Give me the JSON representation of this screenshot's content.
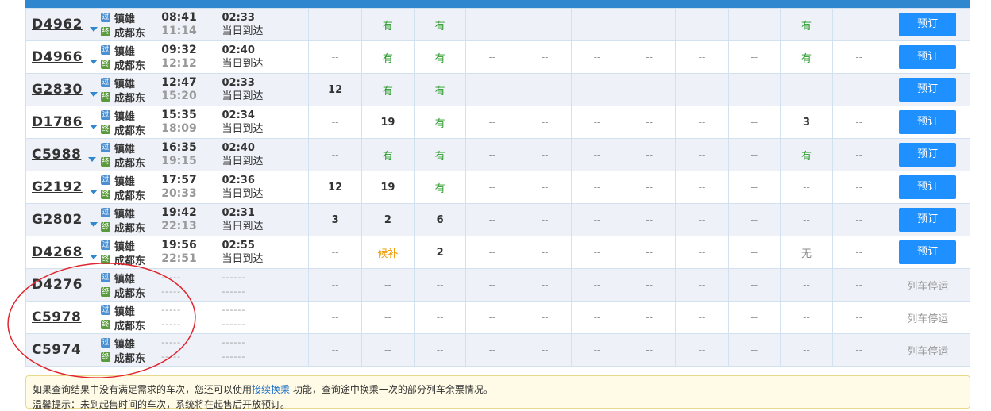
{
  "rows": [
    {
      "train": "D4962",
      "from_badge": "过",
      "from": "镇雄",
      "to_badge": "终",
      "to": "成都东",
      "dep": "08:41",
      "arr": "11:14",
      "dur": "02:33",
      "note": "当日到达",
      "seats": [
        "--",
        "有",
        "有",
        "--",
        "--",
        "--",
        "--",
        "--",
        "--",
        "有",
        "--"
      ],
      "action": "预订",
      "bookable": true
    },
    {
      "train": "D4966",
      "from_badge": "过",
      "from": "镇雄",
      "to_badge": "终",
      "to": "成都东",
      "dep": "09:32",
      "arr": "12:12",
      "dur": "02:40",
      "note": "当日到达",
      "seats": [
        "--",
        "有",
        "有",
        "--",
        "--",
        "--",
        "--",
        "--",
        "--",
        "有",
        "--"
      ],
      "action": "预订",
      "bookable": true
    },
    {
      "train": "G2830",
      "from_badge": "过",
      "from": "镇雄",
      "to_badge": "终",
      "to": "成都东",
      "dep": "12:47",
      "arr": "15:20",
      "dur": "02:33",
      "note": "当日到达",
      "seats": [
        "12",
        "有",
        "有",
        "--",
        "--",
        "--",
        "--",
        "--",
        "--",
        "--",
        "--"
      ],
      "action": "预订",
      "bookable": true
    },
    {
      "train": "D1786",
      "from_badge": "过",
      "from": "镇雄",
      "to_badge": "终",
      "to": "成都东",
      "dep": "15:35",
      "arr": "18:09",
      "dur": "02:34",
      "note": "当日到达",
      "seats": [
        "--",
        "19",
        "有",
        "--",
        "--",
        "--",
        "--",
        "--",
        "--",
        "3",
        "--"
      ],
      "action": "预订",
      "bookable": true
    },
    {
      "train": "C5988",
      "from_badge": "过",
      "from": "镇雄",
      "to_badge": "终",
      "to": "成都东",
      "dep": "16:35",
      "arr": "19:15",
      "dur": "02:40",
      "note": "当日到达",
      "seats": [
        "--",
        "有",
        "有",
        "--",
        "--",
        "--",
        "--",
        "--",
        "--",
        "有",
        "--"
      ],
      "action": "预订",
      "bookable": true
    },
    {
      "train": "G2192",
      "from_badge": "过",
      "from": "镇雄",
      "to_badge": "终",
      "to": "成都东",
      "dep": "17:57",
      "arr": "20:33",
      "dur": "02:36",
      "note": "当日到达",
      "seats": [
        "12",
        "19",
        "有",
        "--",
        "--",
        "--",
        "--",
        "--",
        "--",
        "--",
        "--"
      ],
      "action": "预订",
      "bookable": true
    },
    {
      "train": "G2802",
      "from_badge": "过",
      "from": "镇雄",
      "to_badge": "终",
      "to": "成都东",
      "dep": "19:42",
      "arr": "22:13",
      "dur": "02:31",
      "note": "当日到达",
      "seats": [
        "3",
        "2",
        "6",
        "--",
        "--",
        "--",
        "--",
        "--",
        "--",
        "--",
        "--"
      ],
      "action": "预订",
      "bookable": true
    },
    {
      "train": "D4268",
      "from_badge": "过",
      "from": "镇雄",
      "to_badge": "终",
      "to": "成都东",
      "dep": "19:56",
      "arr": "22:51",
      "dur": "02:55",
      "note": "当日到达",
      "seats": [
        "--",
        "候补",
        "2",
        "--",
        "--",
        "--",
        "--",
        "--",
        "--",
        "无",
        "--"
      ],
      "action": "预订",
      "bookable": true
    },
    {
      "train": "D4276",
      "from_badge": "过",
      "from": "镇雄",
      "to_badge": "终",
      "to": "成都东",
      "dep": "-----",
      "arr": "-----",
      "dur": "------",
      "note": "------",
      "seats": [
        "--",
        "--",
        "--",
        "--",
        "--",
        "--",
        "--",
        "--",
        "--",
        "--",
        "--"
      ],
      "action": "列车停运",
      "bookable": false
    },
    {
      "train": "C5978",
      "from_badge": "过",
      "from": "镇雄",
      "to_badge": "终",
      "to": "成都东",
      "dep": "-----",
      "arr": "-----",
      "dur": "------",
      "note": "------",
      "seats": [
        "--",
        "--",
        "--",
        "--",
        "--",
        "--",
        "--",
        "--",
        "--",
        "--",
        "--"
      ],
      "action": "列车停运",
      "bookable": false
    },
    {
      "train": "C5974",
      "from_badge": "过",
      "from": "镇雄",
      "to_badge": "终",
      "to": "成都东",
      "dep": "-----",
      "arr": "-----",
      "dur": "------",
      "note": "------",
      "seats": [
        "--",
        "--",
        "--",
        "--",
        "--",
        "--",
        "--",
        "--",
        "--",
        "--",
        "--"
      ],
      "action": "列车停运",
      "bookable": false
    }
  ],
  "notice": {
    "line1_prefix": "如果查询结果中没有满足需求的车次，您还可以使用",
    "line1_link": "接续换乘",
    "line1_suffix": " 功能，查询途中换乘一次的部分列车余票情况。",
    "line2": "温馨提示：未到起售时间的车次，系统将在起售后开放预订。"
  },
  "colors": {
    "accent": "#1e90ff",
    "available": "#2a9a2a",
    "waitlist": "#ee9a00",
    "annotation": "#e0262e"
  }
}
